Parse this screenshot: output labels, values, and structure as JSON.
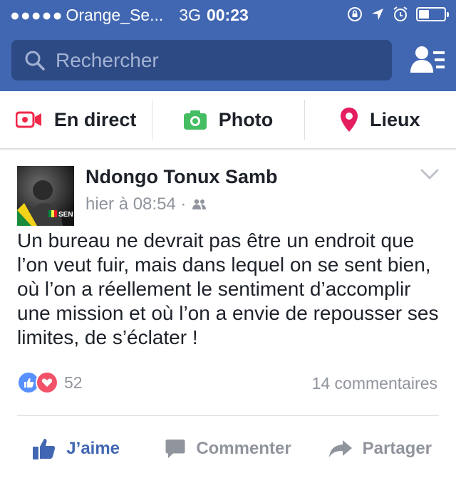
{
  "status_bar": {
    "signal": "●●●●●",
    "carrier": "Orange_Se...",
    "network": "3G",
    "time": "00:23"
  },
  "search": {
    "placeholder": "Rechercher"
  },
  "composer": {
    "live_label": "En direct",
    "photo_label": "Photo",
    "places_label": "Lieux"
  },
  "post": {
    "author": "Ndongo Tonux Samb",
    "timestamp": "hier à 08:54 ·",
    "avatar_badge": "SEN",
    "text": "Un bureau ne devrait pas être un endroit que l’on veut fuir, mais dans lequel on se sent bien, où l’on a réellement le sentiment d’accomplir une mission et où l’on a envie de repousser ses limites, de s’éclater !",
    "reactions_count": "52",
    "comments_count": "14 commentaires",
    "like_label": "J’aime",
    "comment_label": "Commenter",
    "share_label": "Partager"
  },
  "colors": {
    "brand": "#4267b2",
    "live_red": "#f02849",
    "photo_green": "#45bd62",
    "places_pink": "#e41e5f"
  }
}
